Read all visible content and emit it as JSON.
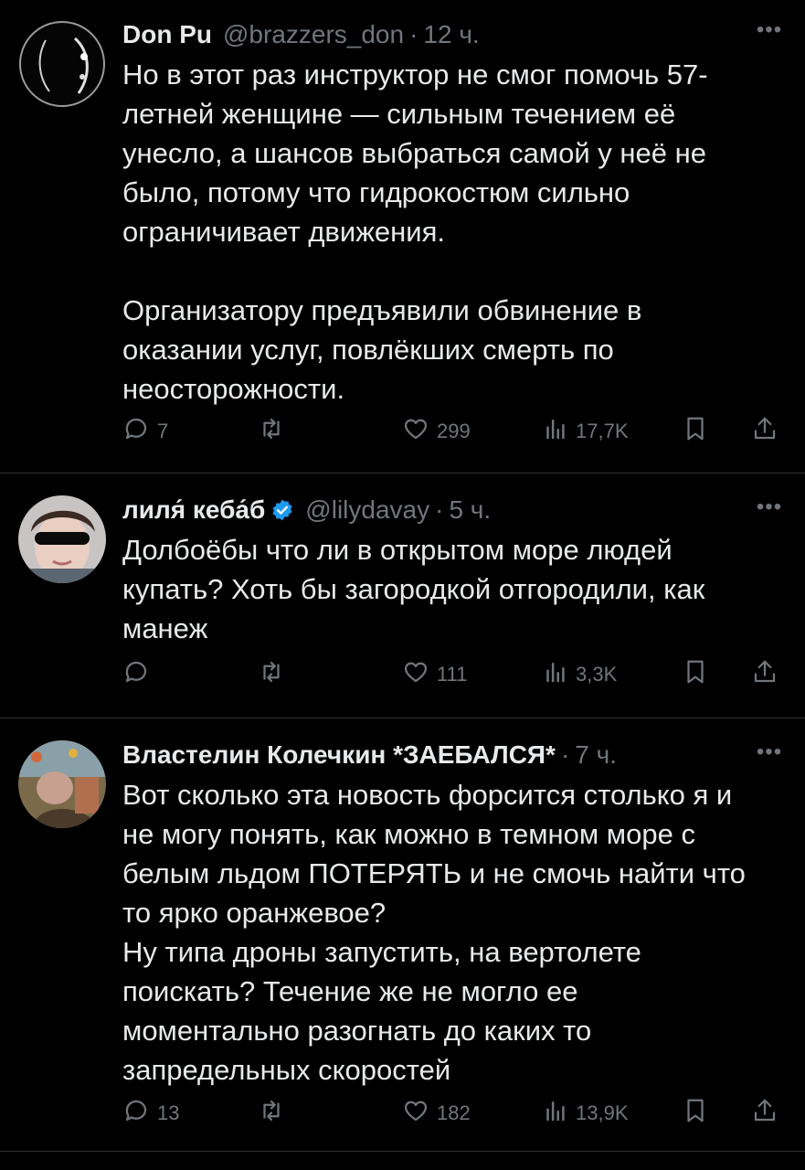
{
  "tweets": [
    {
      "name": "Don Pu",
      "handle": "@brazzers_don",
      "separator": "·",
      "time": "12 ч.",
      "text": "Но в этот раз инструктор не смог помочь 57-\nлетней женщине — сильным течением её\nунесло, а шансов выбраться самой у неё не\nбыло, потому что гидрокостюм сильно\nограничивает движения.\n\nОрганизатору предъявили обвинение в\nоказании услуг, повлёкших смерть по\nнеосторожности.",
      "replies": "7",
      "retweets": "",
      "likes": "299",
      "views": "17,7K"
    },
    {
      "name": "лиля́ кеба́б",
      "handle": "@lilydavay",
      "separator": "·",
      "time": "5 ч.",
      "text": "Долбоёбы что ли в открытом море людей\nкупать? Хоть бы загородкой отгородили, как\nманеж",
      "replies": "",
      "retweets": "",
      "likes": "111",
      "views": "3,3K"
    },
    {
      "name": "Властелин Колечкин *ЗАЕБАЛСЯ*",
      "handle": "",
      "separator": "·",
      "time": "7 ч.",
      "text": "Вот сколько эта новость форсится столько я и\nне могу понять, как можно в темном море с\nбелым льдом ПОТЕРЯТЬ и не смочь найти что\nто ярко оранжевое?\nНу типа дроны запустить, на вертолете\nпоискать? Течение же не могло ее\nмоментально разогнать до каких то\nзапредельных скоростей",
      "replies": "13",
      "retweets": "",
      "likes": "182",
      "views": "13,9K"
    }
  ],
  "icons": {
    "more": "more-horizontal-icon",
    "reply": "reply-bubble-icon",
    "retweet": "retweet-icon",
    "like": "heart-icon",
    "views": "views-bars-icon",
    "bookmark": "bookmark-icon",
    "share": "share-icon",
    "verified": "verified-badge-icon"
  },
  "colors": {
    "background": "#000000",
    "text": "#e7e9ea",
    "secondary": "#71767b",
    "divider": "#2f3336",
    "verified": "#1d9bf0"
  }
}
